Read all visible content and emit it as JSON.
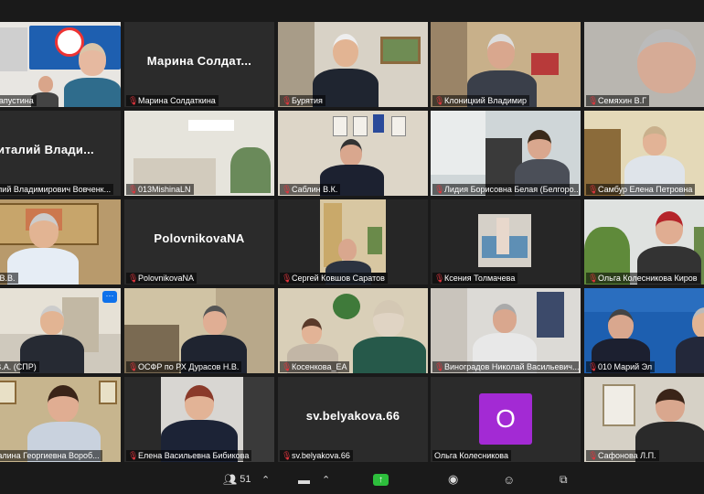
{
  "participants": [
    {
      "name": "га Капустина",
      "big": ""
    },
    {
      "name": "Марина Солдаткина",
      "big": "Марина Солдат..."
    },
    {
      "name": "Бурятия",
      "big": ""
    },
    {
      "name": "Клоницкий Владимир",
      "big": ""
    },
    {
      "name": "Семяхин В.Г",
      "big": ""
    },
    {
      "name": "италий Владимирович Вовченк...",
      "big": "италий Влади..."
    },
    {
      "name": "013MishinaLN",
      "big": ""
    },
    {
      "name": "Саблин В.К.",
      "big": ""
    },
    {
      "name": "Лидия Борисовна Белая (Белгоро...",
      "big": ""
    },
    {
      "name": "Самбур Елена Петровна",
      "big": ""
    },
    {
      "name": "кий В.В.",
      "big": ""
    },
    {
      "name": "PolovnikovaNA",
      "big": "PolovnikovaNA"
    },
    {
      "name": "Сергей Ковшов Саратов",
      "big": ""
    },
    {
      "name": "Ксения Толмачева",
      "big": ""
    },
    {
      "name": "Ольга Колесникова Киров",
      "big": ""
    },
    {
      "name": "ев В.А. (СПР)",
      "big": ""
    },
    {
      "name": "ОСФР по РХ Дурасов Н.В.",
      "big": ""
    },
    {
      "name": "Косенкова_ЕА",
      "big": ""
    },
    {
      "name": "Виноградов Николай Васильевич...",
      "big": ""
    },
    {
      "name": "010 Марий Эл",
      "big": ""
    },
    {
      "name": "анГалина Георгиевна Вороб...",
      "big": ""
    },
    {
      "name": "Елена Васильевна Бибикова",
      "big": ""
    },
    {
      "name": "sv.belyakova.66",
      "big": "sv.belyakova.66"
    },
    {
      "name": "Ольга Колесникова",
      "big": "",
      "avatar": "O"
    },
    {
      "name": "Сафонова Л.П.",
      "big": ""
    }
  ],
  "more_button": "···",
  "toolbar": {
    "participants_count": "51",
    "participants_icon": "participants-icon",
    "chat_icon": "chat-icon",
    "share_icon": "share-screen-icon",
    "record_icon": "record-icon",
    "reactions_icon": "reactions-icon",
    "apps_icon": "apps-icon"
  }
}
